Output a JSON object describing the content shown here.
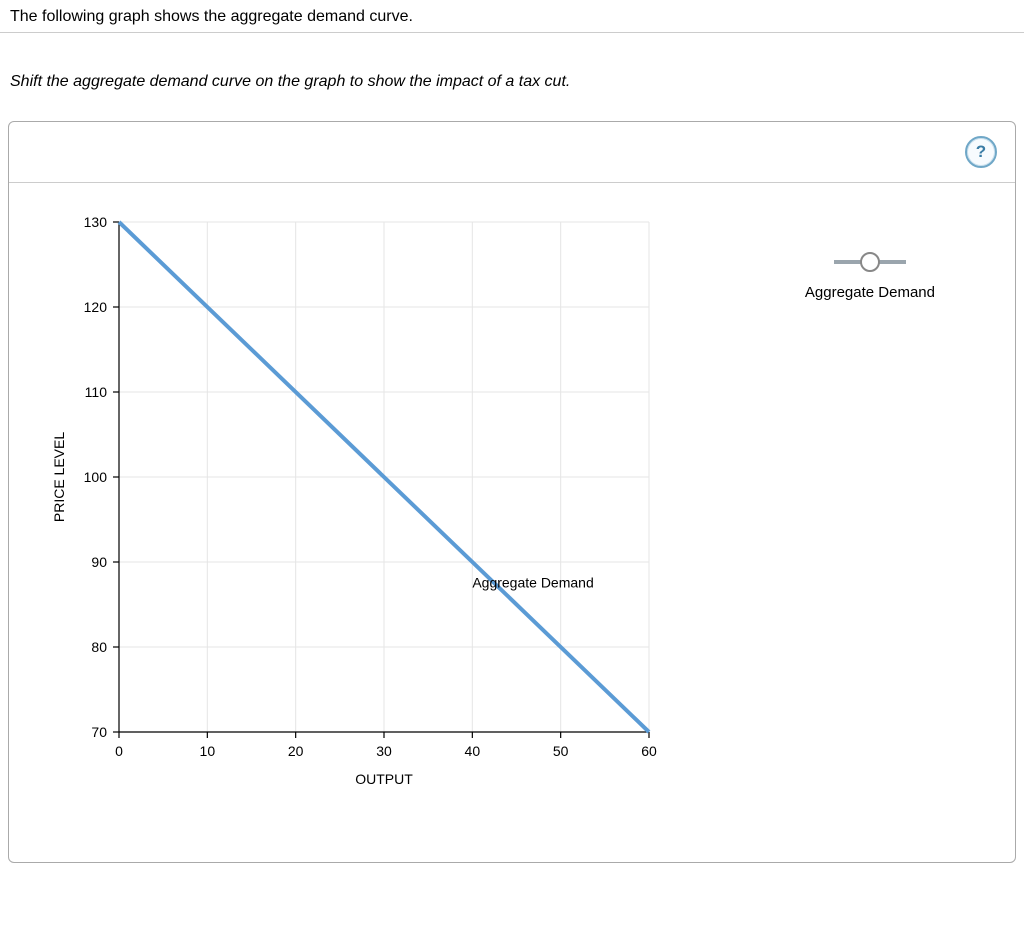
{
  "intro_text": "The following graph shows the aggregate demand curve.",
  "instruction_text": "Shift the aggregate demand curve on the graph to show the impact of a tax cut.",
  "help": "?",
  "legend": {
    "label": "Aggregate Demand"
  },
  "chart_data": {
    "type": "line",
    "title": "",
    "xlabel": "OUTPUT",
    "ylabel": "PRICE LEVEL",
    "xlim": [
      0,
      60
    ],
    "ylim": [
      70,
      130
    ],
    "x_ticks": [
      0,
      10,
      20,
      30,
      40,
      50,
      60
    ],
    "y_ticks": [
      70,
      80,
      90,
      100,
      110,
      120,
      130
    ],
    "grid": true,
    "series": [
      {
        "name": "Aggregate Demand",
        "x": [
          0,
          60
        ],
        "y": [
          130,
          70
        ],
        "color": "#5b9bd5"
      }
    ],
    "series_label_pos": {
      "x": 40,
      "y": 87
    }
  }
}
